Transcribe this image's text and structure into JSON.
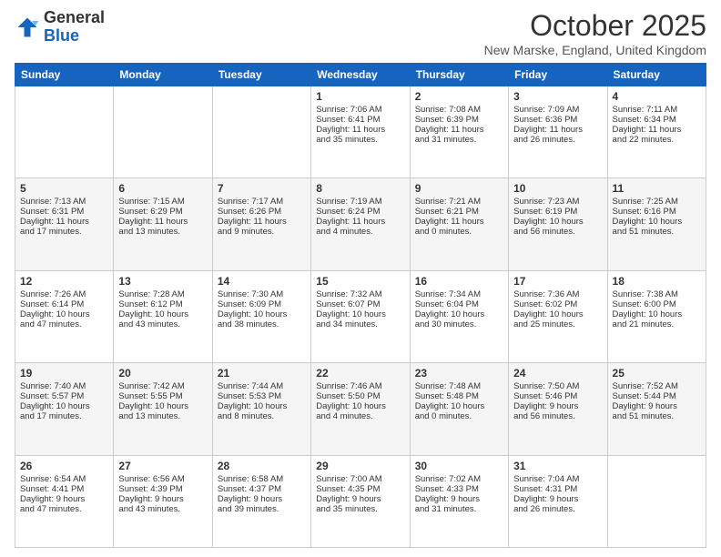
{
  "header": {
    "logo_general": "General",
    "logo_blue": "Blue",
    "month": "October 2025",
    "location": "New Marske, England, United Kingdom"
  },
  "days_of_week": [
    "Sunday",
    "Monday",
    "Tuesday",
    "Wednesday",
    "Thursday",
    "Friday",
    "Saturday"
  ],
  "weeks": [
    [
      {
        "day": "",
        "info": ""
      },
      {
        "day": "",
        "info": ""
      },
      {
        "day": "",
        "info": ""
      },
      {
        "day": "1",
        "info": "Sunrise: 7:06 AM\nSunset: 6:41 PM\nDaylight: 11 hours\nand 35 minutes."
      },
      {
        "day": "2",
        "info": "Sunrise: 7:08 AM\nSunset: 6:39 PM\nDaylight: 11 hours\nand 31 minutes."
      },
      {
        "day": "3",
        "info": "Sunrise: 7:09 AM\nSunset: 6:36 PM\nDaylight: 11 hours\nand 26 minutes."
      },
      {
        "day": "4",
        "info": "Sunrise: 7:11 AM\nSunset: 6:34 PM\nDaylight: 11 hours\nand 22 minutes."
      }
    ],
    [
      {
        "day": "5",
        "info": "Sunrise: 7:13 AM\nSunset: 6:31 PM\nDaylight: 11 hours\nand 17 minutes."
      },
      {
        "day": "6",
        "info": "Sunrise: 7:15 AM\nSunset: 6:29 PM\nDaylight: 11 hours\nand 13 minutes."
      },
      {
        "day": "7",
        "info": "Sunrise: 7:17 AM\nSunset: 6:26 PM\nDaylight: 11 hours\nand 9 minutes."
      },
      {
        "day": "8",
        "info": "Sunrise: 7:19 AM\nSunset: 6:24 PM\nDaylight: 11 hours\nand 4 minutes."
      },
      {
        "day": "9",
        "info": "Sunrise: 7:21 AM\nSunset: 6:21 PM\nDaylight: 11 hours\nand 0 minutes."
      },
      {
        "day": "10",
        "info": "Sunrise: 7:23 AM\nSunset: 6:19 PM\nDaylight: 10 hours\nand 56 minutes."
      },
      {
        "day": "11",
        "info": "Sunrise: 7:25 AM\nSunset: 6:16 PM\nDaylight: 10 hours\nand 51 minutes."
      }
    ],
    [
      {
        "day": "12",
        "info": "Sunrise: 7:26 AM\nSunset: 6:14 PM\nDaylight: 10 hours\nand 47 minutes."
      },
      {
        "day": "13",
        "info": "Sunrise: 7:28 AM\nSunset: 6:12 PM\nDaylight: 10 hours\nand 43 minutes."
      },
      {
        "day": "14",
        "info": "Sunrise: 7:30 AM\nSunset: 6:09 PM\nDaylight: 10 hours\nand 38 minutes."
      },
      {
        "day": "15",
        "info": "Sunrise: 7:32 AM\nSunset: 6:07 PM\nDaylight: 10 hours\nand 34 minutes."
      },
      {
        "day": "16",
        "info": "Sunrise: 7:34 AM\nSunset: 6:04 PM\nDaylight: 10 hours\nand 30 minutes."
      },
      {
        "day": "17",
        "info": "Sunrise: 7:36 AM\nSunset: 6:02 PM\nDaylight: 10 hours\nand 25 minutes."
      },
      {
        "day": "18",
        "info": "Sunrise: 7:38 AM\nSunset: 6:00 PM\nDaylight: 10 hours\nand 21 minutes."
      }
    ],
    [
      {
        "day": "19",
        "info": "Sunrise: 7:40 AM\nSunset: 5:57 PM\nDaylight: 10 hours\nand 17 minutes."
      },
      {
        "day": "20",
        "info": "Sunrise: 7:42 AM\nSunset: 5:55 PM\nDaylight: 10 hours\nand 13 minutes."
      },
      {
        "day": "21",
        "info": "Sunrise: 7:44 AM\nSunset: 5:53 PM\nDaylight: 10 hours\nand 8 minutes."
      },
      {
        "day": "22",
        "info": "Sunrise: 7:46 AM\nSunset: 5:50 PM\nDaylight: 10 hours\nand 4 minutes."
      },
      {
        "day": "23",
        "info": "Sunrise: 7:48 AM\nSunset: 5:48 PM\nDaylight: 10 hours\nand 0 minutes."
      },
      {
        "day": "24",
        "info": "Sunrise: 7:50 AM\nSunset: 5:46 PM\nDaylight: 9 hours\nand 56 minutes."
      },
      {
        "day": "25",
        "info": "Sunrise: 7:52 AM\nSunset: 5:44 PM\nDaylight: 9 hours\nand 51 minutes."
      }
    ],
    [
      {
        "day": "26",
        "info": "Sunrise: 6:54 AM\nSunset: 4:41 PM\nDaylight: 9 hours\nand 47 minutes."
      },
      {
        "day": "27",
        "info": "Sunrise: 6:56 AM\nSunset: 4:39 PM\nDaylight: 9 hours\nand 43 minutes."
      },
      {
        "day": "28",
        "info": "Sunrise: 6:58 AM\nSunset: 4:37 PM\nDaylight: 9 hours\nand 39 minutes."
      },
      {
        "day": "29",
        "info": "Sunrise: 7:00 AM\nSunset: 4:35 PM\nDaylight: 9 hours\nand 35 minutes."
      },
      {
        "day": "30",
        "info": "Sunrise: 7:02 AM\nSunset: 4:33 PM\nDaylight: 9 hours\nand 31 minutes."
      },
      {
        "day": "31",
        "info": "Sunrise: 7:04 AM\nSunset: 4:31 PM\nDaylight: 9 hours\nand 26 minutes."
      },
      {
        "day": "",
        "info": ""
      }
    ]
  ]
}
